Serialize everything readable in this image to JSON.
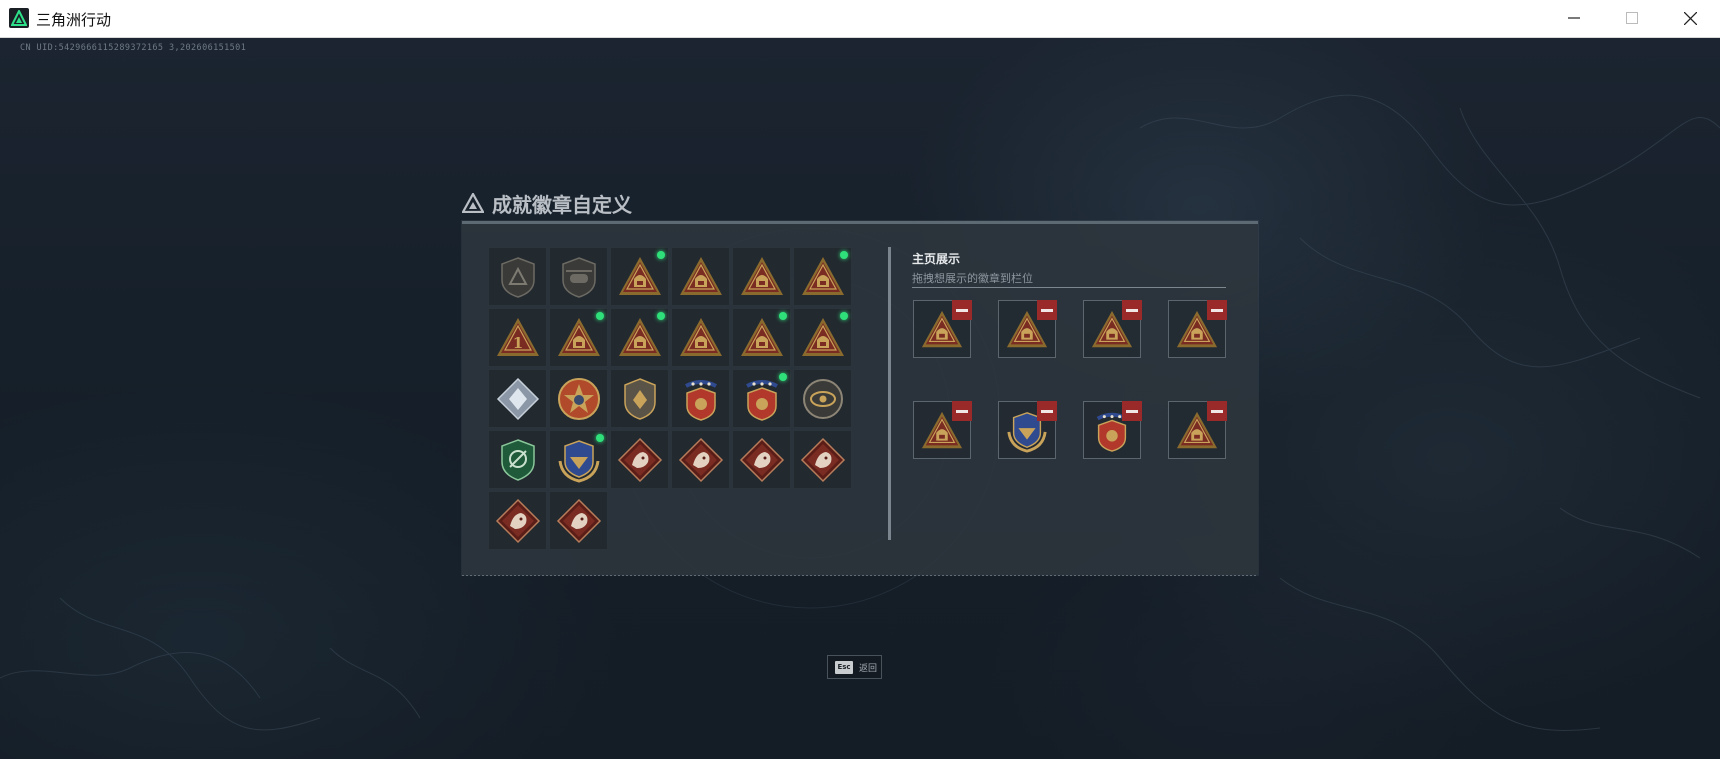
{
  "window": {
    "title": "三角洲行动",
    "controls": [
      "minimize-icon",
      "maximize-icon",
      "close-icon"
    ]
  },
  "uid_line": "CN UID:5429666115289372165 3,202606151501",
  "dialog": {
    "title": "成就徽章自定义",
    "title_icon": "delta-triangle-icon",
    "badge_grid": {
      "badges": [
        {
          "icon": "shield-triangle-badge-gray",
          "tier": "gray",
          "new": false
        },
        {
          "icon": "helicopter-badge-gray",
          "tier": "gray",
          "new": false
        },
        {
          "icon": "triangle-badge-gold-tower",
          "tier": "gold",
          "new": true
        },
        {
          "icon": "triangle-badge-gold-vehicle",
          "tier": "gold",
          "new": false
        },
        {
          "icon": "triangle-badge-gold-helicopter",
          "tier": "gold",
          "new": false
        },
        {
          "icon": "triangle-badge-gold-helmet",
          "tier": "gold",
          "new": true
        },
        {
          "icon": "triangle-badge-number-one",
          "tier": "gold",
          "new": false
        },
        {
          "icon": "triangle-badge-gold-bottle",
          "tier": "gold",
          "new": true
        },
        {
          "icon": "triangle-badge-gold-soldier",
          "tier": "gold",
          "new": true
        },
        {
          "icon": "triangle-badge-gold-target",
          "tier": "gold",
          "new": false
        },
        {
          "icon": "triangle-badge-gold-tank",
          "tier": "gold",
          "new": true
        },
        {
          "icon": "triangle-badge-gold-rockets",
          "tier": "gold",
          "new": true
        },
        {
          "icon": "diamond-badge-silver",
          "tier": "silver",
          "new": false
        },
        {
          "icon": "star-round-badge",
          "tier": "gold",
          "new": false
        },
        {
          "icon": "shield-wings-badge",
          "tier": "gold",
          "new": false
        },
        {
          "icon": "stars-crest-badge",
          "tier": "gold",
          "new": false
        },
        {
          "icon": "stars-crest-badge-2",
          "tier": "gold",
          "new": true
        },
        {
          "icon": "eye-round-badge",
          "tier": "gold",
          "new": false
        },
        {
          "icon": "green-shield-badge",
          "tier": "green",
          "new": false
        },
        {
          "icon": "laurel-shield-badge",
          "tier": "gold",
          "new": true
        },
        {
          "icon": "diamond-beast-badge-boar",
          "tier": "red",
          "new": false
        },
        {
          "icon": "diamond-beast-badge-wolf",
          "tier": "red",
          "new": false
        },
        {
          "icon": "diamond-beast-badge-dragon",
          "tier": "red",
          "new": false
        },
        {
          "icon": "diamond-beast-badge-horse",
          "tier": "red",
          "new": false
        },
        {
          "icon": "diamond-beast-badge-ram",
          "tier": "red",
          "new": false
        },
        {
          "icon": "diamond-beast-badge-anchor",
          "tier": "red",
          "new": false
        }
      ]
    },
    "showcase": {
      "title": "主页展示",
      "subtitle": "拖拽想展示的徽章到栏位",
      "remove_icon": "minus-icon",
      "slots": [
        {
          "icon": "triangle-badge-gold-rockets"
        },
        {
          "icon": "triangle-badge-gold-tank"
        },
        {
          "icon": "triangle-badge-gold-tower"
        },
        {
          "icon": "triangle-badge-gold-soldier"
        },
        {
          "icon": "triangle-badge-gold-helmet"
        },
        {
          "icon": "laurel-shield-badge"
        },
        {
          "icon": "stars-crest-badge-2"
        },
        {
          "icon": "triangle-badge-gold-bottle"
        }
      ]
    }
  },
  "esc_hint": {
    "key": "Esc",
    "label": "返回"
  },
  "colors": {
    "background": "#141b24",
    "panel": "#2e363d",
    "gold": "#c9a35a",
    "badge_red": "#7a2b22",
    "new_dot": "#2fe07a",
    "remove_red": "#9a2a2a"
  }
}
